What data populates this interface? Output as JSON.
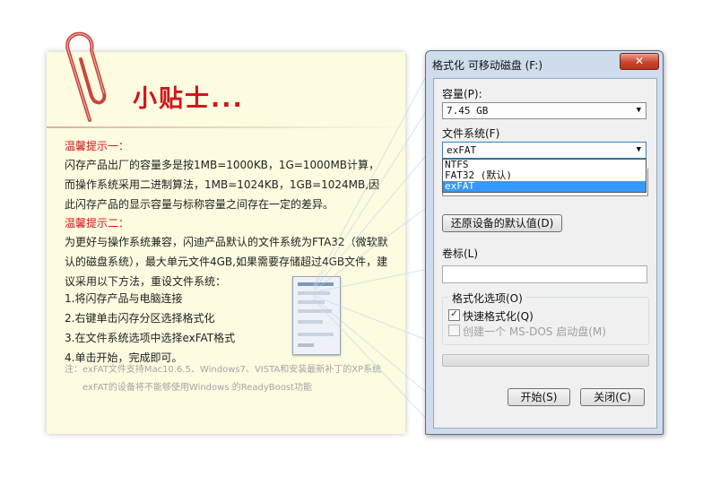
{
  "tips": {
    "title": "小贴士...",
    "tip1_heading": "温馨提示一：",
    "tip1_text": "闪存产品出厂的容量多是按1MB=1000KB，1G=1000MB计算，而操作系统采用二进制算法，1MB=1024KB，1GB=1024MB,因此闪存产品的显示容量与标称容量之间存在一定的差异。",
    "tip2_heading": "温馨提示二：",
    "tip2_text": "为更好与操作系统兼容，闪迪产品默认的文件系统为FTA32（微软默认的磁盘系统），最大单元文件4GB,如果需要存储超过4GB文件，建议采用以下方法，重设文件系统：",
    "steps": [
      "1.将闪存产品与电脑连接",
      "2.右键单击闪存分区选择格式化",
      "3.在文件系统选项中选择exFAT格式",
      "4.单击开始，完成即可。"
    ],
    "note_line1": "注：exFAT文件支持Mac10.6.5、Windows7、VISTA和安装最新补丁的XP系统",
    "note_line2": "exFAT的设备将不能够使用Windows 的ReadyBoost功能"
  },
  "dialog": {
    "title": "格式化 可移动磁盘 (F:)",
    "close_label": "✕",
    "capacity_label": "容量(P):",
    "capacity_value": "7.45 GB",
    "filesystem_label": "文件系统(F)",
    "filesystem_value": "exFAT",
    "filesystem_options": [
      "NTFS",
      "FAT32 (默认)",
      "exFAT"
    ],
    "filesystem_selected_index": 2,
    "restore_defaults_label": "还原设备的默认值(D)",
    "volume_label": "卷标(L)",
    "volume_value": "",
    "format_options_label": "格式化选项(O)",
    "quick_format_label": "快速格式化(Q)",
    "quick_format_checked": true,
    "msdos_label": "创建一个 MS-DOS 启动盘(M)",
    "msdos_checked": false,
    "progress": 0,
    "start_label": "开始(S)",
    "close_button_label": "关闭(C)"
  },
  "colors": {
    "accent_red": "#d3141b",
    "card_bg": "#fdfbe0",
    "selection_blue": "#3399ff"
  },
  "icons": {
    "paperclip": "paperclip-icon",
    "dropdown_arrow": "chevron-down-icon",
    "check": "check-icon"
  }
}
